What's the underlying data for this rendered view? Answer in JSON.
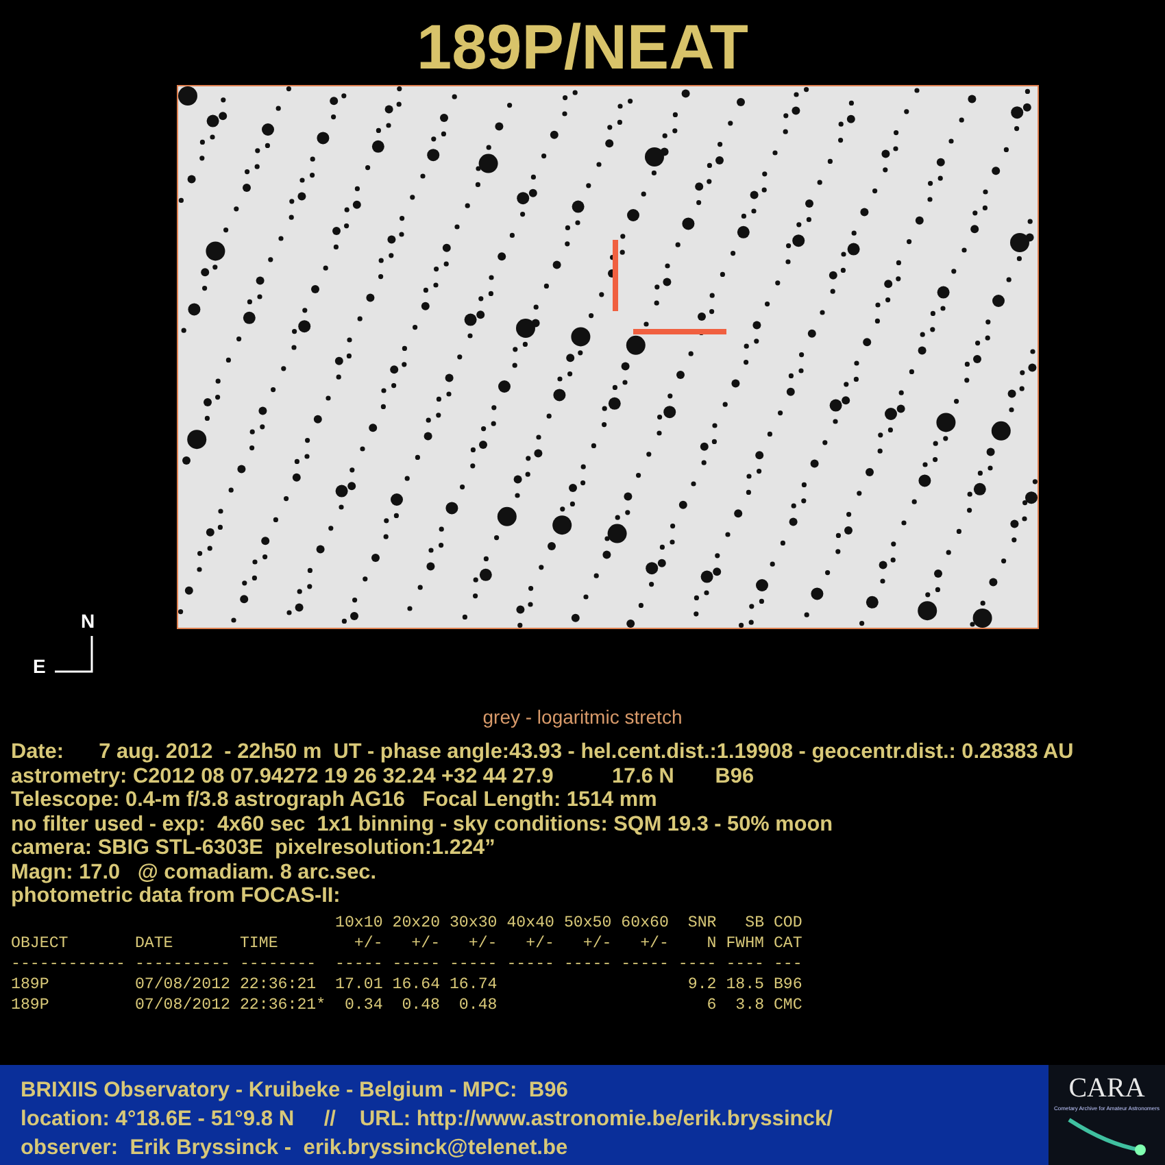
{
  "title": "189P/NEAT",
  "compass": {
    "north": "N",
    "east": "E"
  },
  "caption": "grey - logaritmic stretch",
  "info_lines": [
    "Date:      7 aug. 2012  - 22h50 m  UT - phase angle:43.93 - hel.cent.dist.:1.19908 - geocentr.dist.: 0.28383 AU",
    "astrometry: C2012 08 07.94272 19 26 32.24 +32 44 27.9          17.6 N       B96",
    "Telescope: 0.4-m f/3.8 astrograph AG16   Focal Length: 1514 mm",
    "no filter used - exp:  4x60 sec  1x1 binning - sky conditions: SQM 19.3 - 50% moon",
    "camera: SBIG STL-6303E  pixelresolution:1.224”",
    "Magn: 17.0   @ comadiam. 8 arc.sec.",
    "photometric data from FOCAS-II:"
  ],
  "table": {
    "columns": [
      {
        "head2": "OBJECT",
        "rule": "------------"
      },
      {
        "head2": "DATE",
        "rule": "----------"
      },
      {
        "head2": "TIME",
        "rule": "--------"
      },
      {
        "head1": "10x10",
        "head2": "+/-",
        "rule": "-----"
      },
      {
        "head1": "20x20",
        "head2": "+/-",
        "rule": "-----"
      },
      {
        "head1": "30x30",
        "head2": "+/-",
        "rule": "-----"
      },
      {
        "head1": "40x40",
        "head2": "+/-",
        "rule": "-----"
      },
      {
        "head1": "50x50",
        "head2": "+/-",
        "rule": "-----"
      },
      {
        "head1": "60x60",
        "head2": "+/-",
        "rule": "-----"
      },
      {
        "head1": "SNR",
        "head2": "N",
        "rule": "----"
      },
      {
        "head1": "SB",
        "head2": "FWHM",
        "rule": "----"
      },
      {
        "head1": "COD",
        "head2": "CAT",
        "rule": "---"
      }
    ],
    "rows": [
      [
        "189P",
        "07/08/2012",
        "22:36:21",
        "17.01",
        "16.64",
        "16.74",
        null,
        null,
        null,
        "9.2",
        "18.5",
        "B96"
      ],
      [
        "189P",
        "07/08/2012",
        "22:36:21*",
        "0.34",
        "0.48",
        "0.48",
        null,
        null,
        null,
        "6",
        "3.8",
        "CMC"
      ]
    ]
  },
  "footer": {
    "lines": [
      "BRIXIIS Observatory - Kruibeke - Belgium - MPC:  B96",
      "location: 4°18.6E - 51°9.8 N     //    URL: http://www.astronomie.be/erik.bryssinck/",
      "observer:  Erik Bryssinck -  erik.bryssinck@telenet.be"
    ],
    "logo": {
      "name": "CARA",
      "tagline": "Cometary Archive for Amateur Astronomers"
    }
  }
}
